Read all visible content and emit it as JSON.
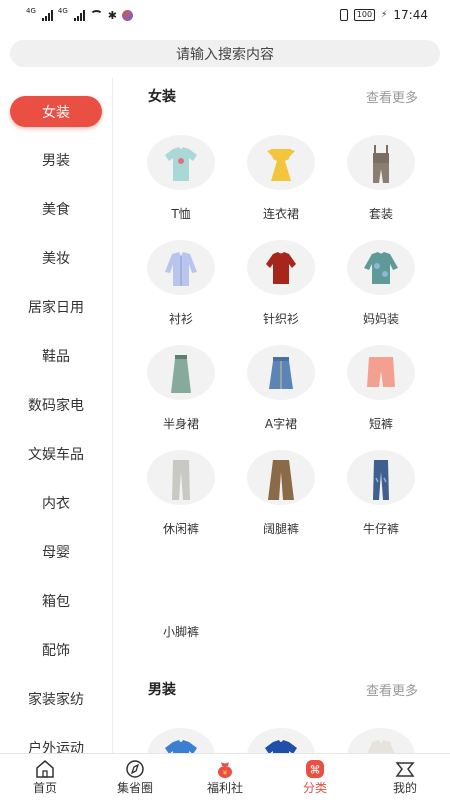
{
  "status_bar": {
    "network_labels": [
      "4G",
      "4G"
    ],
    "vibrate_icon": "vibrate-icon",
    "battery": "100",
    "time": "17:44"
  },
  "search": {
    "placeholder": "请输入搜索内容"
  },
  "sidebar": {
    "items": [
      {
        "label": "女装",
        "active": true
      },
      {
        "label": "男装"
      },
      {
        "label": "美食"
      },
      {
        "label": "美妆"
      },
      {
        "label": "居家日用"
      },
      {
        "label": "鞋品"
      },
      {
        "label": "数码家电"
      },
      {
        "label": "文娱车品"
      },
      {
        "label": "内衣"
      },
      {
        "label": "母婴"
      },
      {
        "label": "箱包"
      },
      {
        "label": "配饰"
      },
      {
        "label": "家装家纺"
      },
      {
        "label": "户外运动"
      }
    ]
  },
  "sections": [
    {
      "title": "女装",
      "more": "查看更多",
      "items": [
        {
          "label": "T恤",
          "icon": "tshirt-icon",
          "color": "#a9d8d6"
        },
        {
          "label": "连衣裙",
          "icon": "dress-icon",
          "color": "#f2c53d"
        },
        {
          "label": "套装",
          "icon": "jumpsuit-icon",
          "color": "#7a6e62"
        },
        {
          "label": "衬衫",
          "icon": "shirt-icon",
          "color": "#b8c6ee"
        },
        {
          "label": "针织衫",
          "icon": "knit-icon",
          "color": "#a6261c"
        },
        {
          "label": "妈妈装",
          "icon": "blouse-icon",
          "color": "#5f9a99"
        },
        {
          "label": "半身裙",
          "icon": "skirt-icon",
          "color": "#86ab9c"
        },
        {
          "label": "A字裙",
          "icon": "denim-skirt-icon",
          "color": "#5c84b8"
        },
        {
          "label": "短裤",
          "icon": "shorts-icon",
          "color": "#f4a090"
        },
        {
          "label": "休闲裤",
          "icon": "pants-icon",
          "color": "#c9c9c4"
        },
        {
          "label": "阔腿裤",
          "icon": "wide-pants-icon",
          "color": "#8a6a47"
        },
        {
          "label": "牛仔裤",
          "icon": "jeans-icon",
          "color": "#3f5f8f"
        },
        {
          "label": "小脚裤",
          "icon": "",
          "color": ""
        }
      ]
    },
    {
      "title": "男装",
      "more": "查看更多",
      "items": [
        {
          "label": "",
          "icon": "tshirt-icon",
          "color": "#3a7fd0"
        },
        {
          "label": "",
          "icon": "tshirt-icon",
          "color": "#1f4fa8"
        },
        {
          "label": "",
          "icon": "shirt-icon",
          "color": "#e6e3dc"
        }
      ]
    }
  ],
  "tabbar": {
    "items": [
      {
        "label": "首页",
        "icon": "home-icon"
      },
      {
        "label": "集省圈",
        "icon": "compass-icon"
      },
      {
        "label": "福利社",
        "icon": "gift-bag-icon"
      },
      {
        "label": "分类",
        "icon": "category-icon",
        "active": true
      },
      {
        "label": "我的",
        "icon": "profile-icon"
      }
    ]
  },
  "colors": {
    "accent": "#e94f43",
    "search_bg": "#f0f0f0",
    "muted": "#999999"
  }
}
